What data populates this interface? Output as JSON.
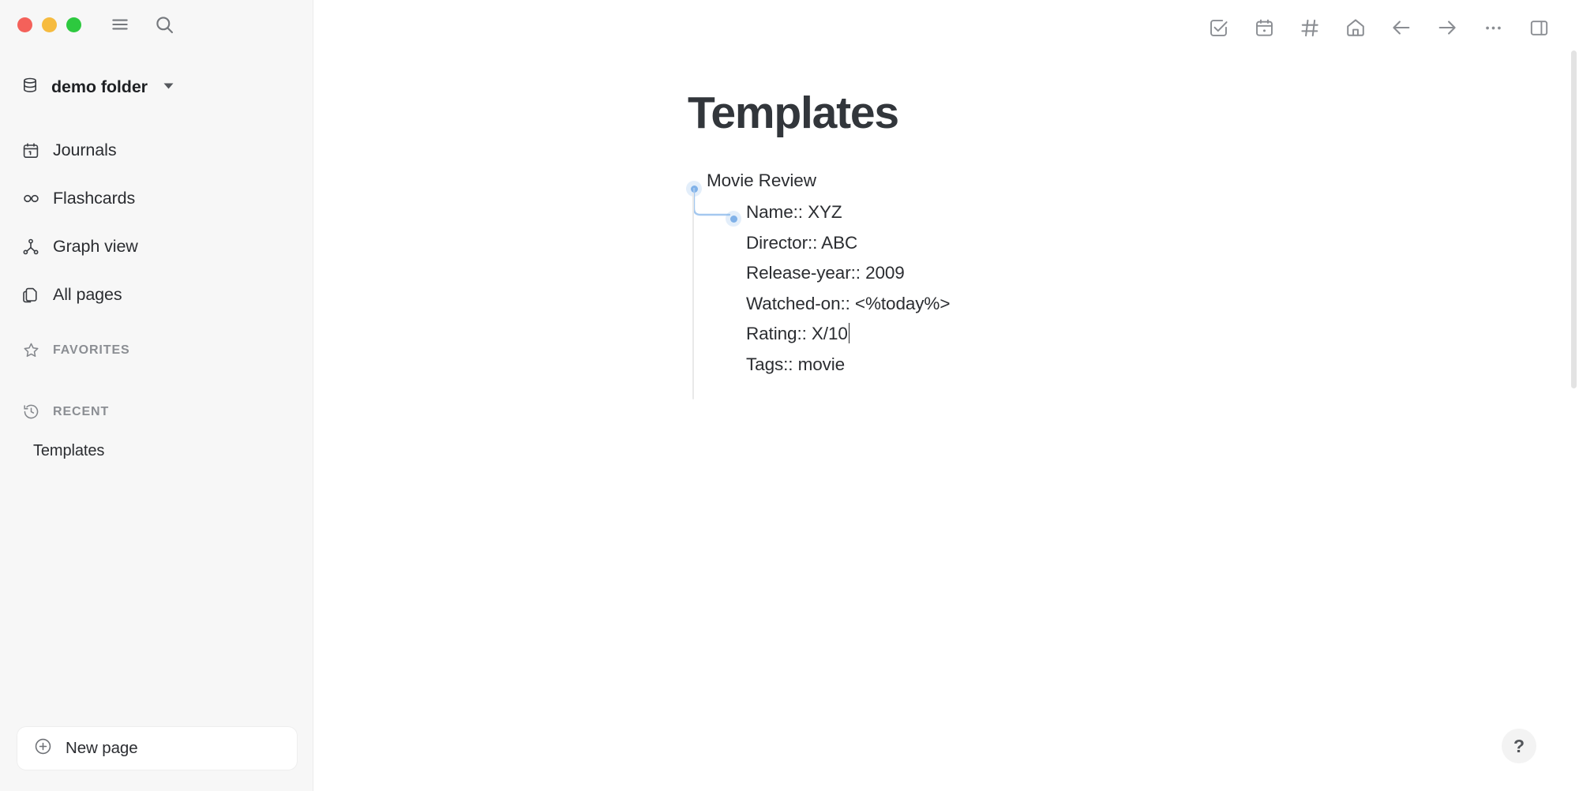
{
  "window": {
    "traffic_lights": [
      {
        "name": "close-button",
        "color": "#f4615a"
      },
      {
        "name": "minimize-button",
        "color": "#f6bb3f"
      },
      {
        "name": "maximize-button",
        "color": "#2dc93f"
      }
    ],
    "tools": [
      {
        "icon": "hamburger-menu-icon",
        "label": "Toggle left sidebar"
      },
      {
        "icon": "search-icon",
        "label": "Search"
      }
    ]
  },
  "sidebar": {
    "graph": {
      "icon": "database-icon",
      "label": "demo folder",
      "caret": "chevron-down-icon"
    },
    "nav_items": [
      {
        "icon": "calendar-icon",
        "label": "Journals"
      },
      {
        "icon": "infinity-icon",
        "label": "Flashcards"
      },
      {
        "icon": "graph-node-icon",
        "label": "Graph view"
      },
      {
        "icon": "pages-copy-icon",
        "label": "All pages"
      }
    ],
    "sections": [
      {
        "icon": "star-icon",
        "label": "FAVORITES",
        "items": []
      },
      {
        "icon": "history-icon",
        "label": "RECENT",
        "items": [
          "Templates"
        ]
      }
    ],
    "recent_item": "Templates",
    "new_page": {
      "icon": "plus-circle-icon",
      "label": "New page"
    },
    "background_color": "#f7f7f7"
  },
  "toolbar": {
    "buttons": [
      {
        "icon": "checkbox-square-icon",
        "label": "Todo"
      },
      {
        "icon": "calendar-icon",
        "label": "Journals"
      },
      {
        "icon": "hash-icon",
        "label": "Tags"
      },
      {
        "icon": "home-icon",
        "label": "Home"
      },
      {
        "icon": "arrow-left-icon",
        "label": "Go back"
      },
      {
        "icon": "arrow-right-icon",
        "label": "Go forward"
      },
      {
        "icon": "ellipsis-icon",
        "label": "More options"
      },
      {
        "icon": "right-sidebar-icon",
        "label": "Toggle right sidebar"
      }
    ]
  },
  "page": {
    "title": "Templates",
    "blocks": {
      "parent": {
        "text": "Movie Review",
        "bullet_color": "#80b1e8"
      },
      "child": {
        "bullet_color": "#80b1e8",
        "lines": [
          "Name:: XYZ",
          "Director:: ABC",
          "Release-year:: 2009",
          "Watched-on:: <%today%>",
          "Rating:: X/10",
          "Tags:: movie"
        ],
        "caret_after_line_index": 4
      }
    }
  },
  "help": {
    "icon": "question-mark-icon",
    "label": "?"
  },
  "scrollbar": {
    "name": "main-scrollbar",
    "thumb_color": "#e3e3e3"
  },
  "colors": {
    "accent": "#80b1e8",
    "text": "#2b2d31",
    "title": "#32363b",
    "muted": "#8b8e93",
    "sidebar_bg": "#f7f7f7",
    "main_bg": "#ffffff",
    "guideline": "#e9e9e9"
  }
}
